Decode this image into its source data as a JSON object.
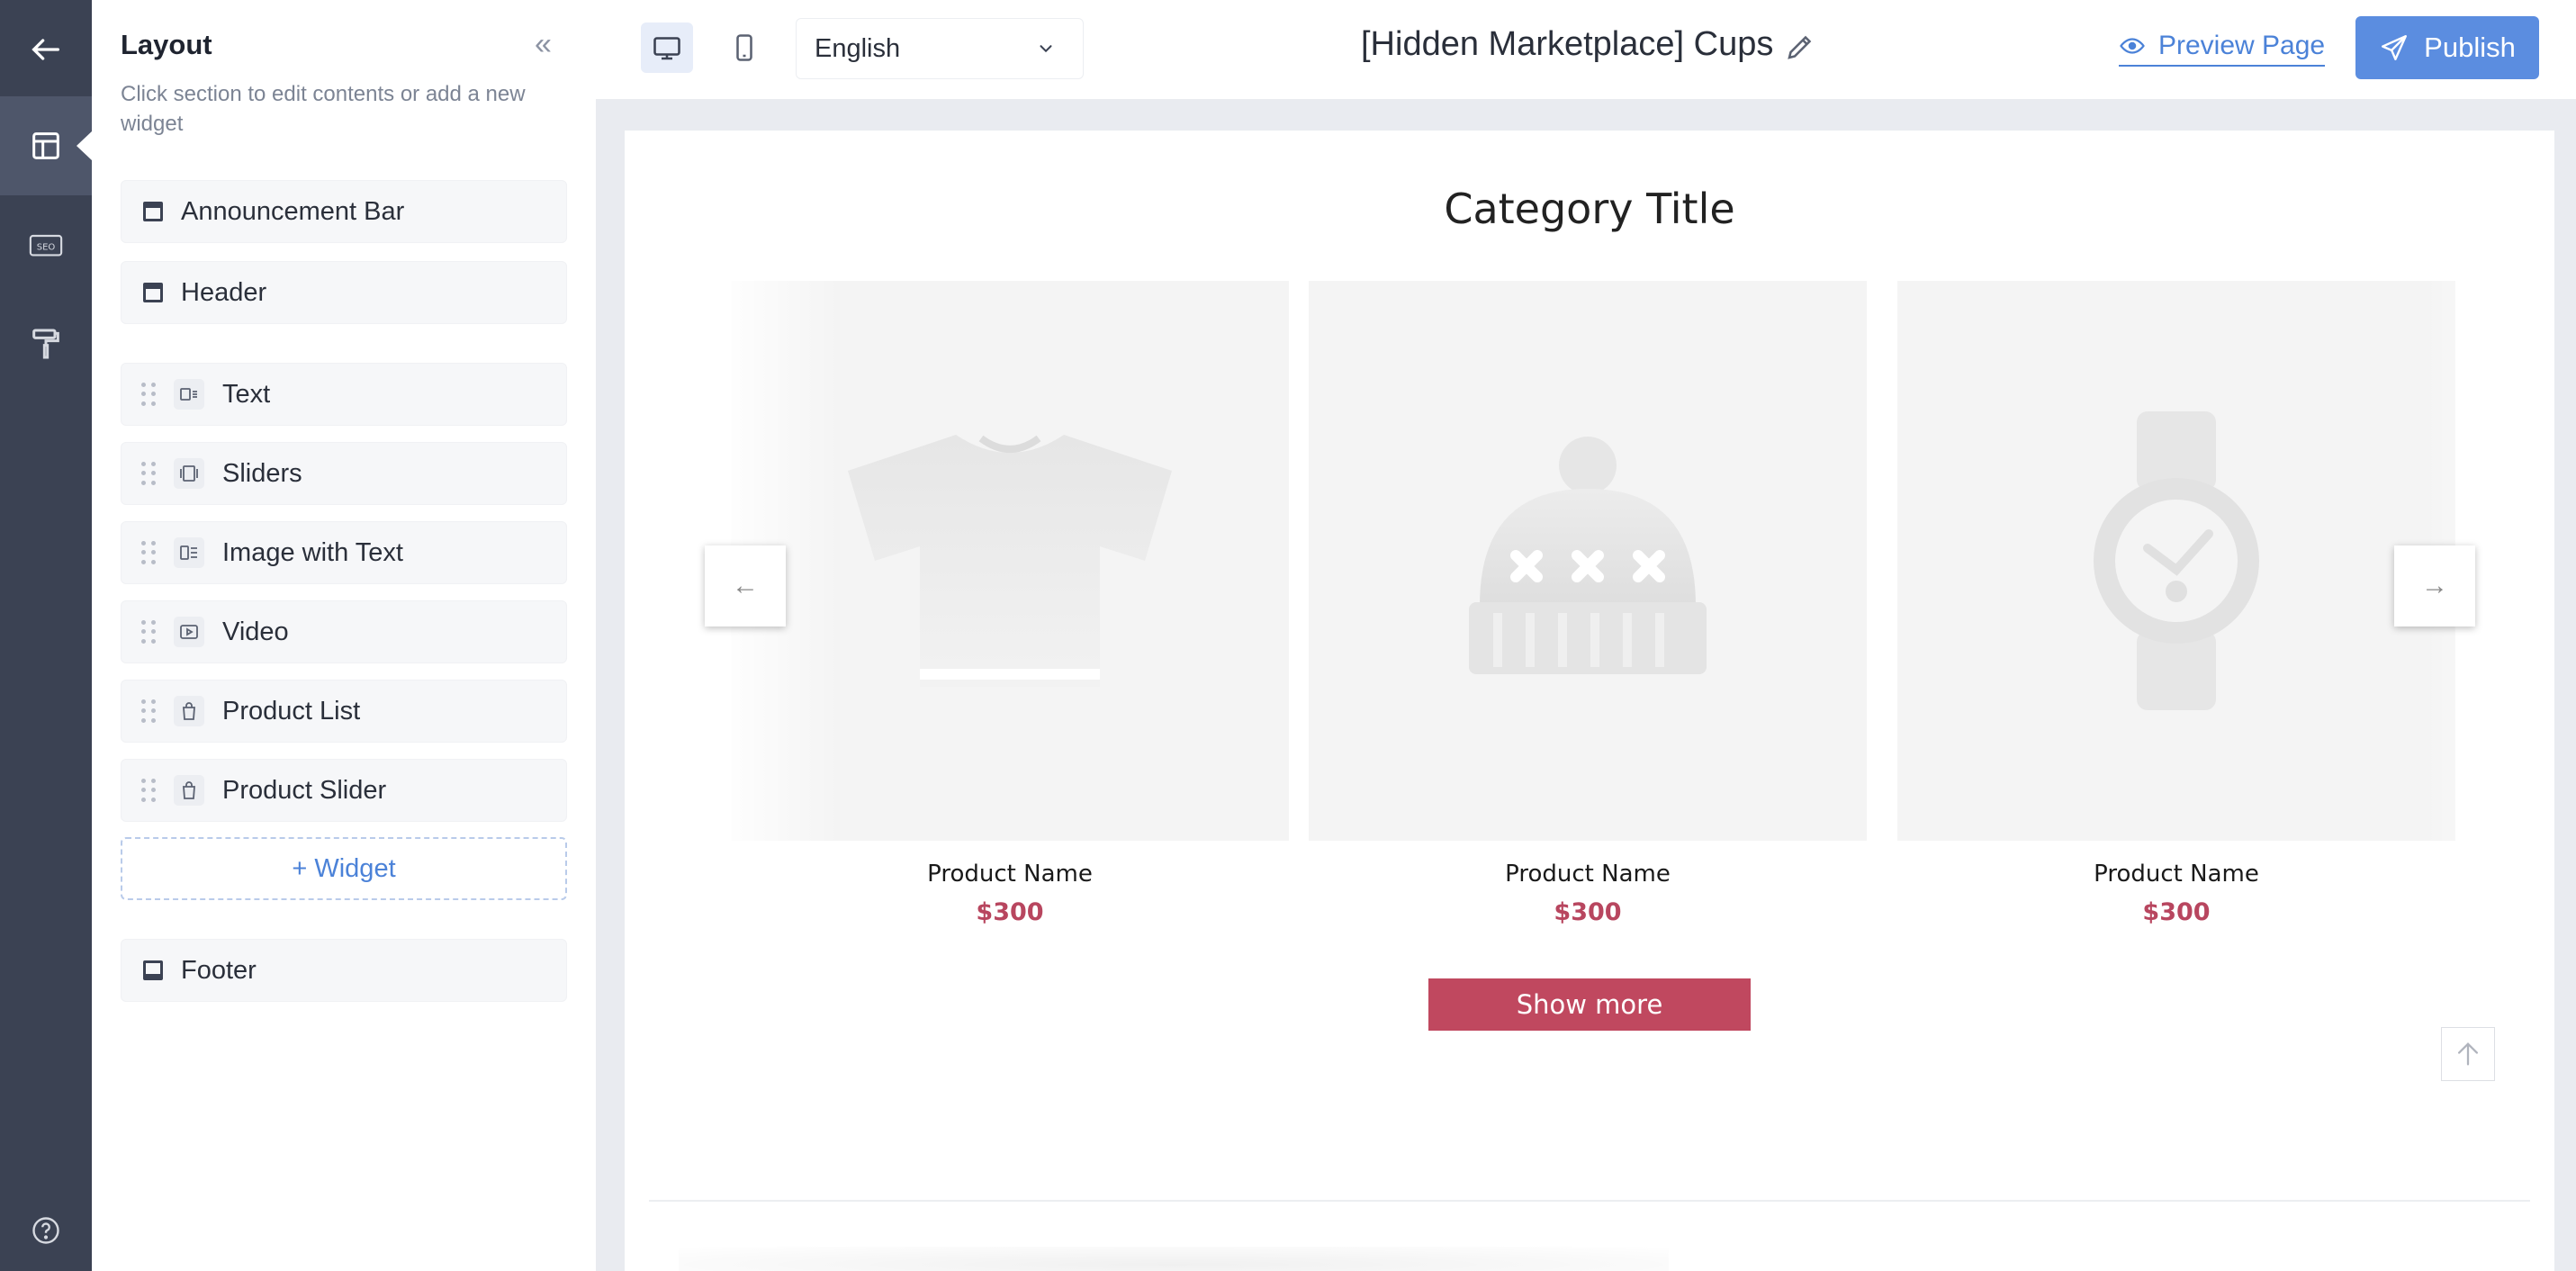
{
  "rail": {
    "items": [
      {
        "name": "back",
        "icon": "arrow-left-icon"
      },
      {
        "name": "layout",
        "icon": "layout-icon",
        "active": true
      },
      {
        "name": "seo",
        "icon": "seo-icon"
      },
      {
        "name": "theme",
        "icon": "paint-roller-icon"
      },
      {
        "name": "help",
        "icon": "help-circle-icon"
      }
    ]
  },
  "panel": {
    "title": "Layout",
    "collapse_icon": "«",
    "description": "Click section to edit contents or add a new widget",
    "fixed_top": [
      {
        "label": "Announcement Bar"
      },
      {
        "label": "Header"
      }
    ],
    "widgets": [
      {
        "label": "Text",
        "icon": "text-widget-icon"
      },
      {
        "label": "Sliders",
        "icon": "slider-widget-icon"
      },
      {
        "label": "Image with Text",
        "icon": "image-text-widget-icon"
      },
      {
        "label": "Video",
        "icon": "video-widget-icon"
      },
      {
        "label": "Product List",
        "icon": "bag-icon"
      },
      {
        "label": "Product Slider",
        "icon": "bag-icon"
      }
    ],
    "add_widget": "+ Widget",
    "footer": {
      "label": "Footer"
    }
  },
  "topbar": {
    "language": "English",
    "page_name": "[Hidden Marketplace] Cups",
    "preview": "Preview Page",
    "publish": "Publish"
  },
  "canvas": {
    "category_title": "Category Title",
    "products": [
      {
        "name": "Product Name",
        "price": "$300",
        "image": "tshirt-icon"
      },
      {
        "name": "Product Name",
        "price": "$300",
        "image": "beanie-icon"
      },
      {
        "name": "Product Name",
        "price": "$300",
        "image": "watch-icon"
      }
    ],
    "prev_arrow": "←",
    "next_arrow": "→",
    "show_more": "Show more"
  },
  "colors": {
    "rail": "#3b4253",
    "accent": "#5b8de0",
    "price": "#b8465f",
    "show_more": "#c0485f"
  }
}
